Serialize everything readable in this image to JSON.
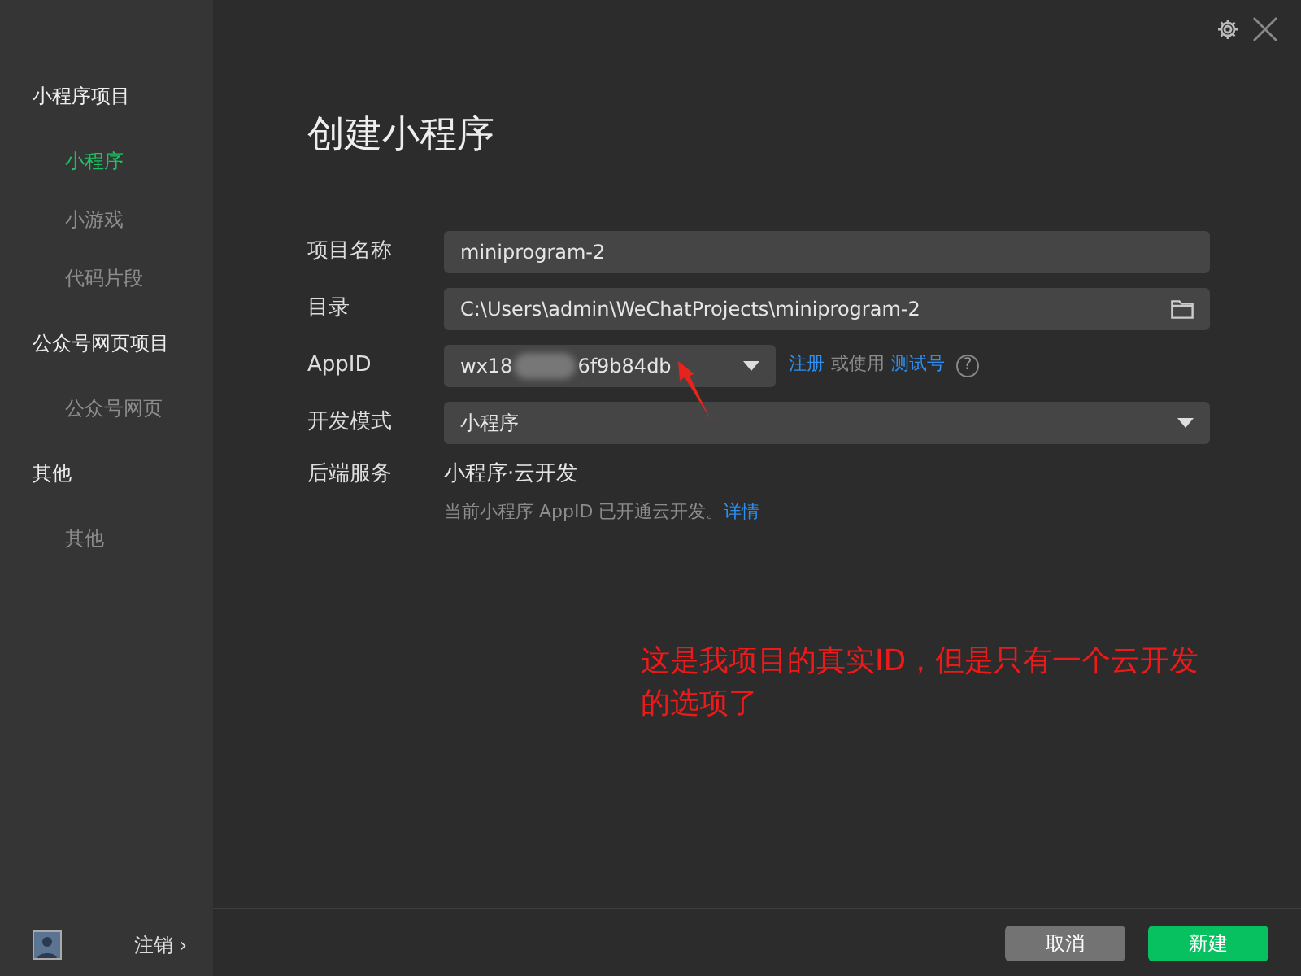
{
  "sidebar": {
    "groups": [
      {
        "title": "小程序项目",
        "items": [
          {
            "label": "小程序",
            "selected": true
          },
          {
            "label": "小游戏",
            "selected": false
          },
          {
            "label": "代码片段",
            "selected": false
          }
        ]
      },
      {
        "title": "公众号网页项目",
        "items": [
          {
            "label": "公众号网页",
            "selected": false
          }
        ]
      },
      {
        "title": "其他",
        "items": [
          {
            "label": "其他",
            "selected": false
          }
        ]
      }
    ],
    "logout": "注销 ›"
  },
  "heading": "创建小程序",
  "form": [
    {
      "kind": "text",
      "label": "项目名称",
      "value": "miniprogram-2"
    },
    {
      "kind": "folder",
      "label": "目录",
      "value": "C:\\Users\\admin\\WeChatProjects\\miniprogram-2"
    },
    {
      "kind": "appid",
      "label": "AppID",
      "value_start": "wx18",
      "value_end": "6f9b84db",
      "register": "注册",
      "or_use": "或使用",
      "test_account": "测试号",
      "help": "?"
    },
    {
      "kind": "select",
      "label": "开发模式",
      "value": "小程序"
    },
    {
      "kind": "static",
      "label": "后端服务",
      "value": "小程序·云开发",
      "note": "当前小程序 AppID 已开通云开发。",
      "note_link": "详情"
    }
  ],
  "annotation": "这是我项目的真实ID，但是只有一个云开发的选项了",
  "buttons": [
    {
      "label": "取消",
      "kind": "secondary"
    },
    {
      "label": "新建",
      "kind": "primary"
    }
  ]
}
